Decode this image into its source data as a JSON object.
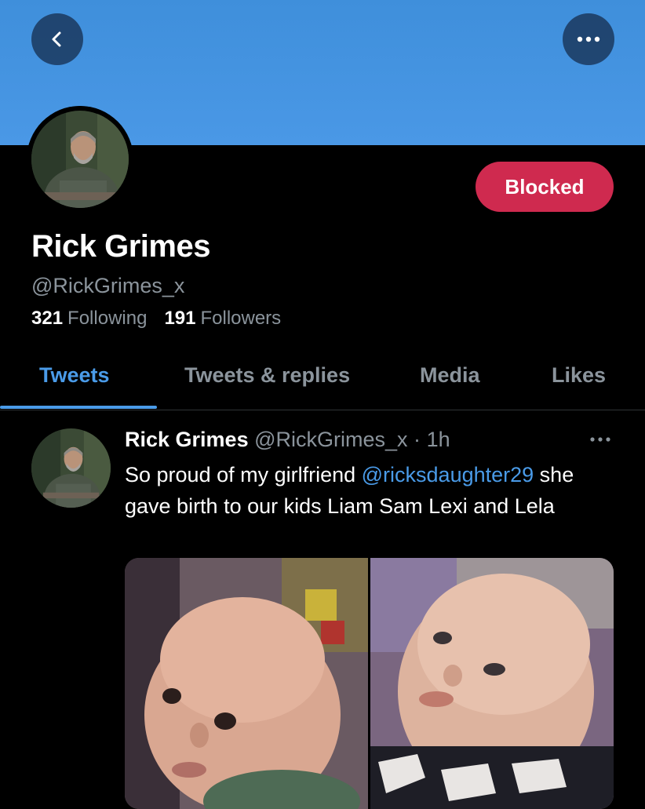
{
  "header": {
    "back_icon": "chevron-left-icon",
    "more_icon": "more-horizontal-icon",
    "banner_color": "#4a98e6"
  },
  "profile": {
    "display_name": "Rick Grimes",
    "handle": "@RickGrimes_x",
    "following_count": "321",
    "following_label": "Following",
    "followers_count": "191",
    "followers_label": "Followers",
    "block_button_label": "Blocked",
    "block_button_color": "#cf2a4f"
  },
  "tabs": [
    {
      "label": "Tweets",
      "active": true
    },
    {
      "label": "Tweets & replies",
      "active": false
    },
    {
      "label": "Media",
      "active": false
    },
    {
      "label": "Likes",
      "active": false
    }
  ],
  "tweet": {
    "author_name": "Rick Grimes",
    "author_handle": "@RickGrimes_x",
    "separator": "·",
    "time": "1h",
    "text_before": "So proud of my girlfriend ",
    "mention": "@ricksdaughter29",
    "text_after": " she gave birth to our kids Liam Sam Lexi and Lela",
    "media_count": 2
  }
}
